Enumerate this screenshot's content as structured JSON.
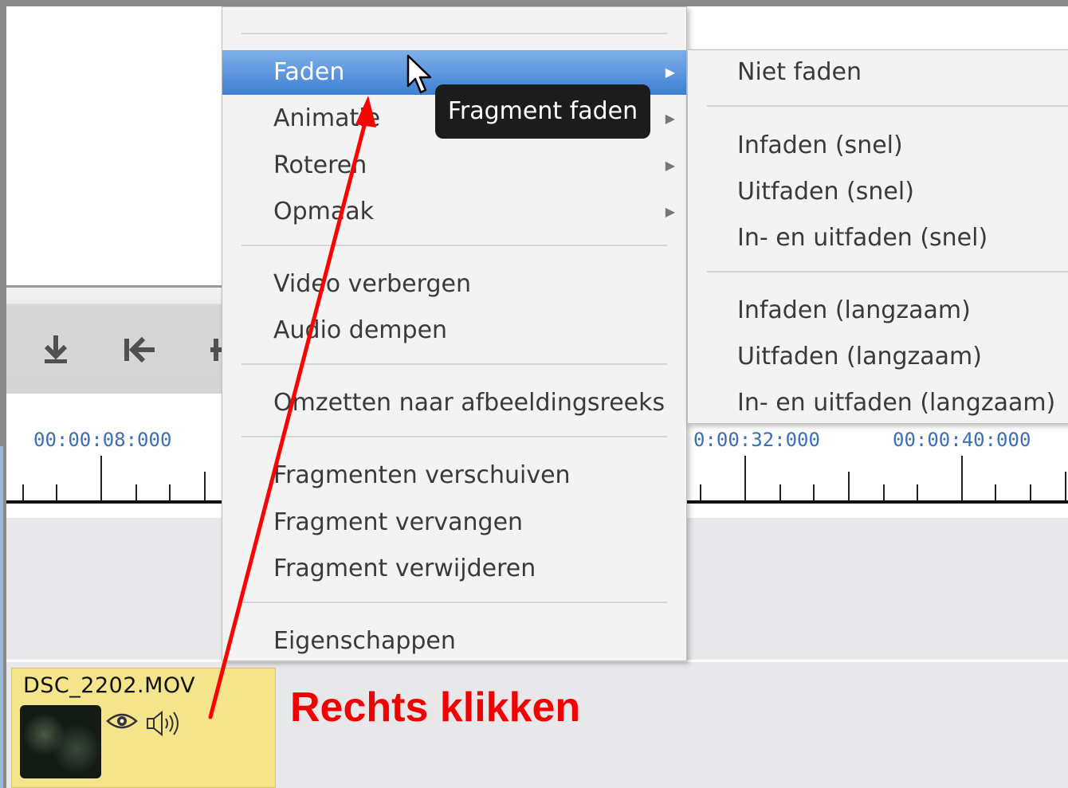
{
  "timeline": {
    "time_labels": [
      "00:00:08:000",
      "0:00:32:000",
      "00:00:40:000"
    ]
  },
  "toolbar": {
    "icons": [
      "download-icon",
      "skip-to-start-icon"
    ]
  },
  "clip": {
    "name": "DSC_2202.MOV",
    "icons": [
      "eye-icon",
      "speaker-icon"
    ]
  },
  "context_menu": {
    "items": [
      {
        "label": "Faden",
        "has_submenu": true,
        "active": true
      },
      {
        "label": "Animatie",
        "has_submenu": true
      },
      {
        "label": "Roteren",
        "has_submenu": true
      },
      {
        "label": "Opmaak",
        "has_submenu": true
      },
      {
        "label": "Video verbergen"
      },
      {
        "label": "Audio dempen"
      },
      {
        "label": "Omzetten naar afbeeldingsreeks"
      },
      {
        "label": "Fragmenten verschuiven"
      },
      {
        "label": "Fragment vervangen"
      },
      {
        "label": "Fragment verwijderen"
      },
      {
        "label": "Eigenschappen"
      }
    ]
  },
  "submenu": {
    "items": [
      {
        "label": "Niet faden"
      },
      {
        "label": "Infaden (snel)"
      },
      {
        "label": "Uitfaden (snel)"
      },
      {
        "label": "In- en uitfaden (snel)"
      },
      {
        "label": "Infaden (langzaam)"
      },
      {
        "label": "Uitfaden (langzaam)"
      },
      {
        "label": "In- en uitfaden (langzaam)"
      }
    ]
  },
  "tooltip": {
    "text": "Fragment faden"
  },
  "annotation": {
    "text": "Rechts klikken",
    "color": "#f00000"
  },
  "colors": {
    "menu_highlight": "#4a88d8",
    "clip_background": "#f4e48b",
    "timecode": "#3c6fb4"
  }
}
